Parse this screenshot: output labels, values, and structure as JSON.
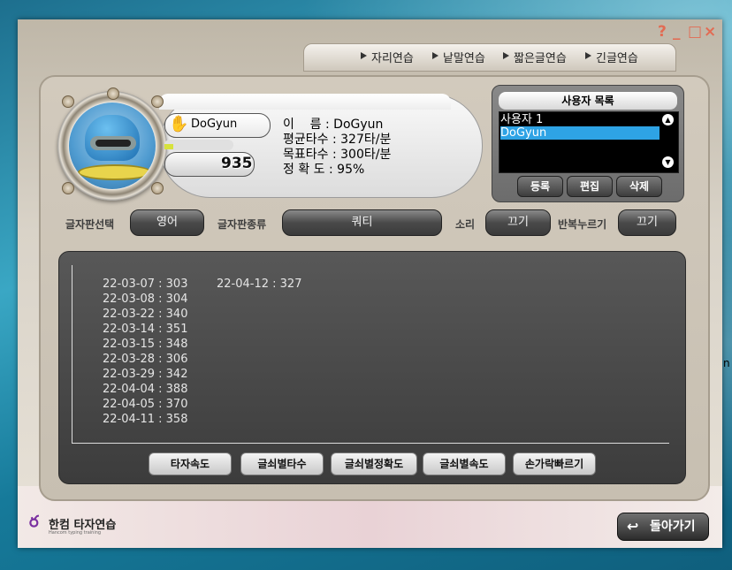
{
  "window": {
    "controls": [
      "?",
      "_",
      "□",
      "×"
    ]
  },
  "tabs": [
    "자리연습",
    "낱말연습",
    "짧은글연습",
    "긴글연습"
  ],
  "profile": {
    "name": "DoGyun",
    "score": "935",
    "level_fraction": 0.1,
    "info_lines": [
      "이    름 : DoGyun",
      "평균타수 : 327타/분",
      "목표타수 : 300타/분",
      "정 확 도 : 95%"
    ]
  },
  "user_list": {
    "title": "사용자 목록",
    "items": [
      "사용자 1",
      "DoGyun"
    ],
    "selected_index": 1,
    "buttons": {
      "register": "등록",
      "edit": "편집",
      "delete": "삭제"
    }
  },
  "settings": {
    "keyboard_select_label": "글자판선택",
    "keyboard_select_value": "영어",
    "keyboard_type_label": "글자판종류",
    "keyboard_type_value": "쿼티",
    "sound_label": "소리",
    "sound_value": "끄기",
    "repeat_label": "반복누르기",
    "repeat_value": "끄기"
  },
  "records": {
    "col1": [
      "22-03-07 : 303",
      "22-03-08 : 304",
      "22-03-22 : 340",
      "22-03-14 : 351",
      "22-03-15 : 348",
      "22-03-28 : 306",
      "22-03-29 : 342",
      "22-04-04 : 388",
      "22-04-05 : 370",
      "22-04-11 : 358"
    ],
    "col2": [
      "22-04-12 : 327"
    ]
  },
  "graph_buttons": [
    "타자속도",
    "글쇠별타수",
    "글쇠별정확도",
    "글쇠별속도",
    "손가락빠르기"
  ],
  "logo": {
    "text": "한컴 타자연습",
    "sub": "Hancom typing training"
  },
  "back_button": "돌아가기",
  "side_char": "n"
}
